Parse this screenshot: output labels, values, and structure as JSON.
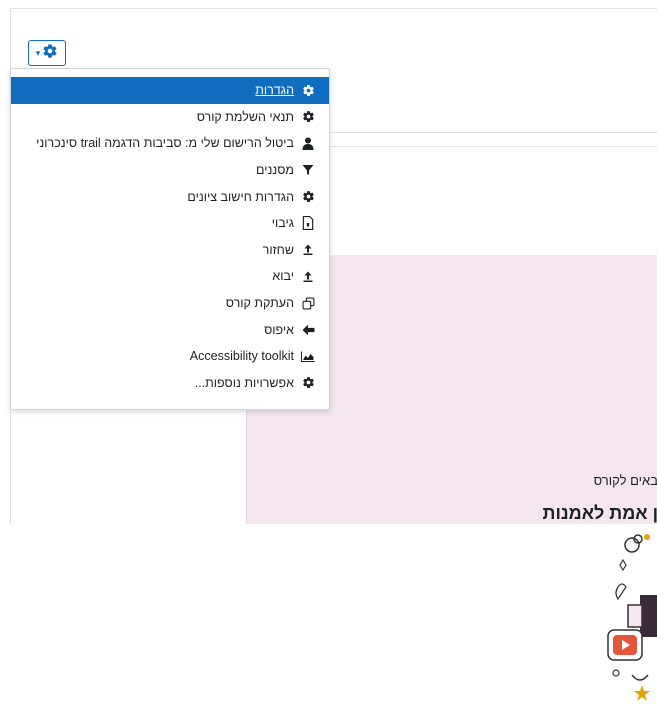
{
  "menu": {
    "items": [
      {
        "label": "הגדרות",
        "icon": "gear-icon"
      },
      {
        "label": "תנאי השלמת קורס",
        "icon": "gear-icon"
      },
      {
        "label": "ביטול הרישום שלי מ: סביבות הדגמה trail סינכרוני",
        "icon": "user-icon"
      },
      {
        "label": "מסננים",
        "icon": "filter-icon"
      },
      {
        "label": "הגדרות חישוב ציונים",
        "icon": "gear-icon"
      },
      {
        "label": "גיבוי",
        "icon": "file-archive-icon"
      },
      {
        "label": "שחזור",
        "icon": "upload-icon"
      },
      {
        "label": "יבוא",
        "icon": "upload-icon"
      },
      {
        "label": "העתקת קורס",
        "icon": "copy-icon"
      },
      {
        "label": "איפוס",
        "icon": "arrow-left-icon"
      },
      {
        "label": "Accessibility toolkit",
        "icon": "area-chart-icon"
      },
      {
        "label": "אפשרויות נוספות...",
        "icon": "gear-icon"
      }
    ]
  },
  "content": {
    "welcome": "באים לקורס",
    "title": "ן אמת לאמנות"
  },
  "colors": {
    "accent": "#0f6cbf",
    "panel_bg": "#f5e6ef"
  }
}
